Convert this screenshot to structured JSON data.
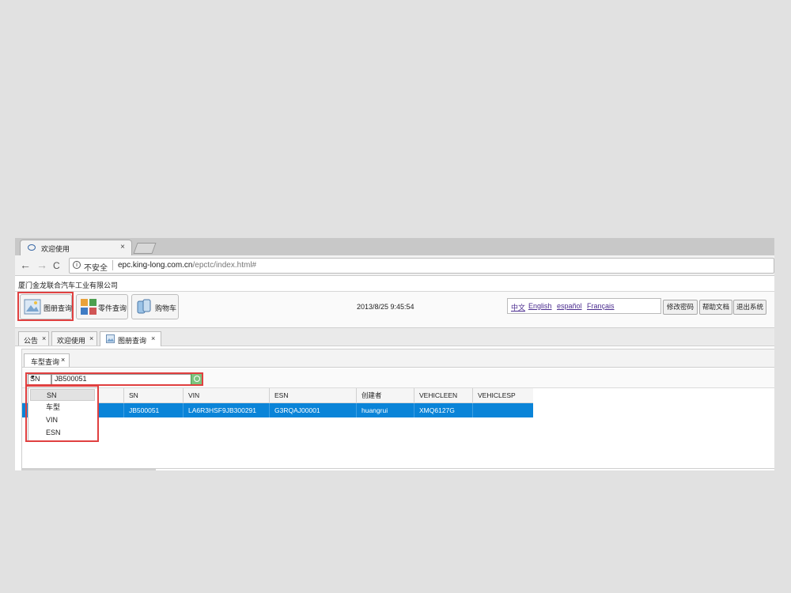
{
  "browser": {
    "tab_title": "欢迎使用",
    "tab_close": "×",
    "nav": {
      "back": "←",
      "forward": "→",
      "reload": "C"
    },
    "security_label": "不安全",
    "url_host": "epc.king-long.com.cn",
    "url_path": "/epctc/index.html#"
  },
  "app": {
    "company": "厦门金龙联合汽车工业有限公司",
    "toolbar": [
      {
        "label": "图册查询",
        "icon": "album-search-icon"
      },
      {
        "label": "零件查询",
        "icon": "parts-search-icon"
      },
      {
        "label": "购物车",
        "icon": "shopping-cart-icon"
      }
    ],
    "datetime": "2013/8/25 9:45:54",
    "languages": [
      "中文",
      "English",
      "español",
      "Français"
    ],
    "actions": [
      "修改密码",
      "帮助文档",
      "退出系统"
    ]
  },
  "tabs": [
    {
      "label": "公告",
      "close": "×"
    },
    {
      "label": "欢迎使用",
      "close": "×"
    },
    {
      "label": "图册查询",
      "close": "×",
      "active": true
    }
  ],
  "subtab": {
    "label": "车型查询",
    "close": "×"
  },
  "search": {
    "field": "SN",
    "arrow": "▼",
    "value": "JB500051",
    "options": [
      "SN",
      "车型",
      "VIN",
      "ESN"
    ]
  },
  "grid": {
    "columns": [
      "SN",
      "VIN",
      "ESN",
      "创建者",
      "VEHICLEEN",
      "VEHICLESP"
    ],
    "rows": [
      [
        "JB500051",
        "LA6R3HSF9JB300291",
        "G3RQAJ00001",
        "huangrui",
        "XMQ6127G",
        ""
      ]
    ]
  },
  "colors": {
    "selected_row": "#0a84d8",
    "highlight": "#e04040"
  }
}
